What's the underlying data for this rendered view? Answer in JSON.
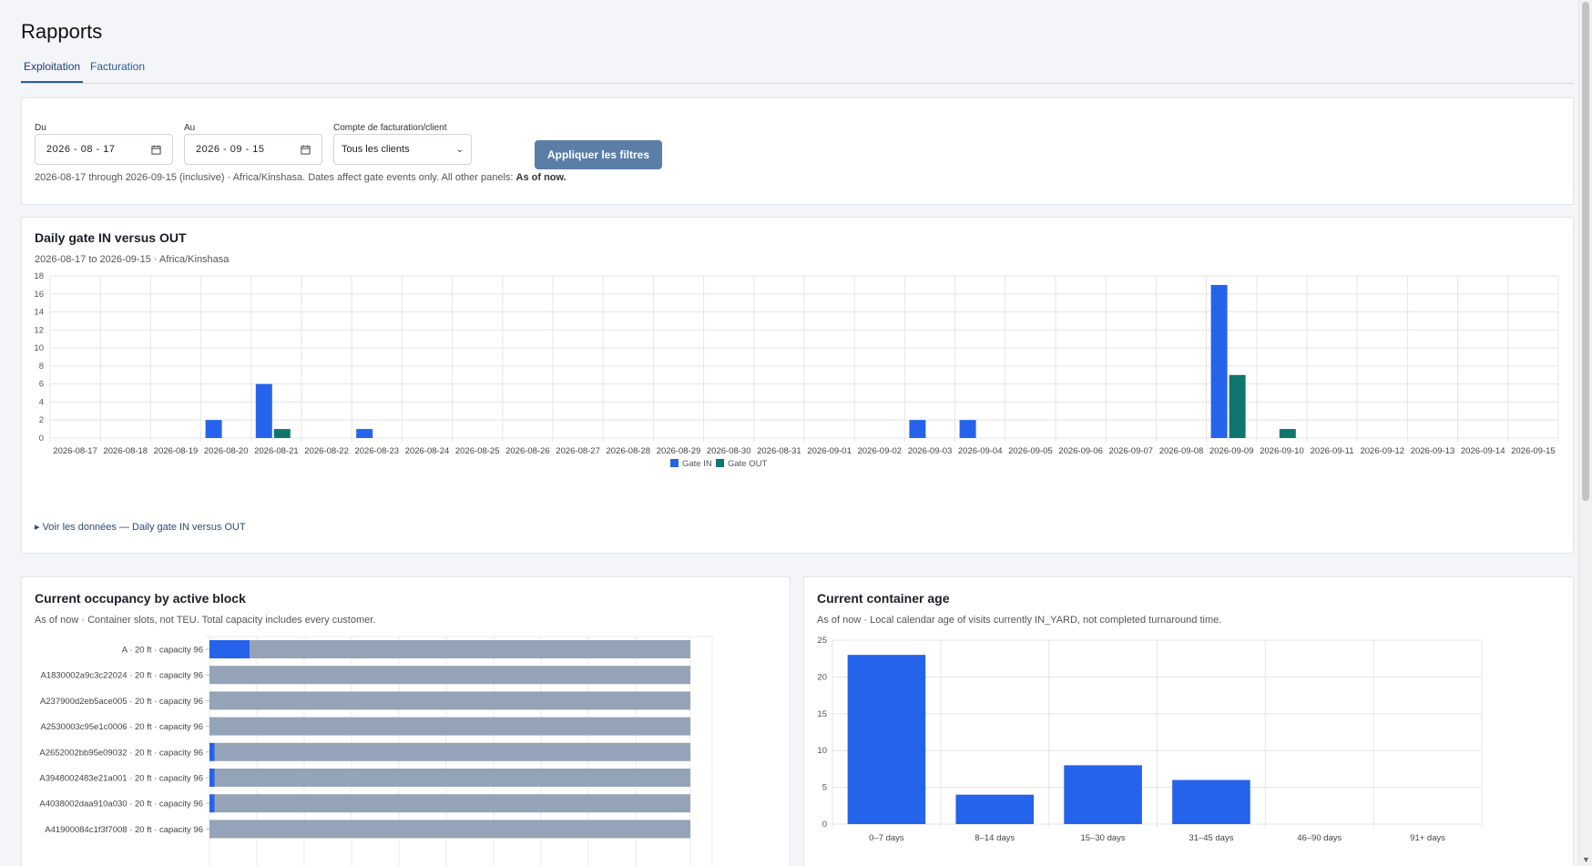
{
  "page": {
    "title": "Rapports"
  },
  "tabs": [
    {
      "label": "Exploitation",
      "active": true
    },
    {
      "label": "Facturation",
      "active": false
    }
  ],
  "filters": {
    "from_label": "Du",
    "from_value": "2026 - 08 - 17",
    "to_label": "Au",
    "to_value": "2026 - 09 - 15",
    "account_label": "Compte de facturation/client",
    "account_value": "Tous les clients",
    "apply_label": "Appliquer les filtres",
    "note_text": "2026-08-17 through 2026-09-15 (inclusive) · Africa/Kinshasa. Dates affect gate events only. All other panels: ",
    "note_bold": "As of now."
  },
  "colors": {
    "gate_in": "#2563eb",
    "gate_out": "#0f766e",
    "capacity": "#94a3b8",
    "accent": "#5b7ea7"
  },
  "daily_chart": {
    "title": "Daily gate IN versus OUT",
    "subtitle": "2026-08-17 to 2026-09-15 · Africa/Kinshasa",
    "toggle_label": "▸ Voir les données — Daily gate IN versus OUT"
  },
  "occupancy_chart": {
    "title": "Current occupancy by active block",
    "subtitle": "As of now · Container slots, not TEU. Total capacity includes every customer."
  },
  "age_chart": {
    "title": "Current container age",
    "subtitle": "As of now · Local calendar age of visits currently IN_YARD, not completed turnaround time."
  },
  "chart_data": [
    {
      "type": "bar",
      "categories": [
        "2026-08-17",
        "2026-08-18",
        "2026-08-19",
        "2026-08-20",
        "2026-08-21",
        "2026-08-22",
        "2026-08-23",
        "2026-08-24",
        "2026-08-25",
        "2026-08-26",
        "2026-08-27",
        "2026-08-28",
        "2026-08-29",
        "2026-08-30",
        "2026-08-31",
        "2026-09-01",
        "2026-09-02",
        "2026-09-03",
        "2026-09-04",
        "2026-09-05",
        "2026-09-06",
        "2026-09-07",
        "2026-09-08",
        "2026-09-09",
        "2026-09-10",
        "2026-09-11",
        "2026-09-12",
        "2026-09-13",
        "2026-09-14",
        "2026-09-15"
      ],
      "series": [
        {
          "name": "Gate IN",
          "values": [
            0,
            0,
            0,
            2,
            6,
            0,
            1,
            0,
            0,
            0,
            0,
            0,
            0,
            0,
            0,
            0,
            0,
            2,
            2,
            0,
            0,
            0,
            0,
            17,
            0,
            0,
            0,
            0,
            0,
            0
          ]
        },
        {
          "name": "Gate OUT",
          "values": [
            0,
            0,
            0,
            0,
            1,
            0,
            0,
            0,
            0,
            0,
            0,
            0,
            0,
            0,
            0,
            0,
            0,
            0,
            0,
            0,
            0,
            0,
            0,
            7,
            1,
            0,
            0,
            0,
            0,
            0
          ]
        }
      ],
      "yticks": [
        0,
        2,
        4,
        6,
        8,
        10,
        12,
        14,
        16,
        18
      ],
      "ylim": [
        0,
        18
      ],
      "grid": true,
      "legend": "bottom-center"
    },
    {
      "type": "bar",
      "orientation": "horizontal",
      "stacked": true,
      "categories": [
        "A · 20 ft · capacity 96",
        "A1830002a9c3c22024 · 20 ft · capacity 96",
        "A237900d2eb5ace005 · 20 ft · capacity 96",
        "A2530003c95e1c0006 · 20 ft · capacity 96",
        "A2652002bb95e09032 · 20 ft · capacity 96",
        "A3948002483e21a001 · 20 ft · capacity 96",
        "A4038002daa910a030 · 20 ft · capacity 96",
        "A41900084c1f3f7008 · 20 ft · capacity 96"
      ],
      "occupied": [
        8,
        0,
        0,
        0,
        1,
        1,
        1,
        0
      ],
      "capacity": [
        96,
        96,
        96,
        96,
        96,
        96,
        96,
        96
      ],
      "xlim": [
        0,
        96
      ],
      "grid": true
    },
    {
      "type": "bar",
      "categories": [
        "0–7 days",
        "8–14 days",
        "15–30 days",
        "31–45 days",
        "46–90 days",
        "91+ days"
      ],
      "values": [
        23,
        4,
        8,
        6,
        0,
        0
      ],
      "yticks": [
        0,
        5,
        10,
        15,
        20,
        25
      ],
      "ylim": [
        0,
        25
      ],
      "grid": true
    }
  ]
}
